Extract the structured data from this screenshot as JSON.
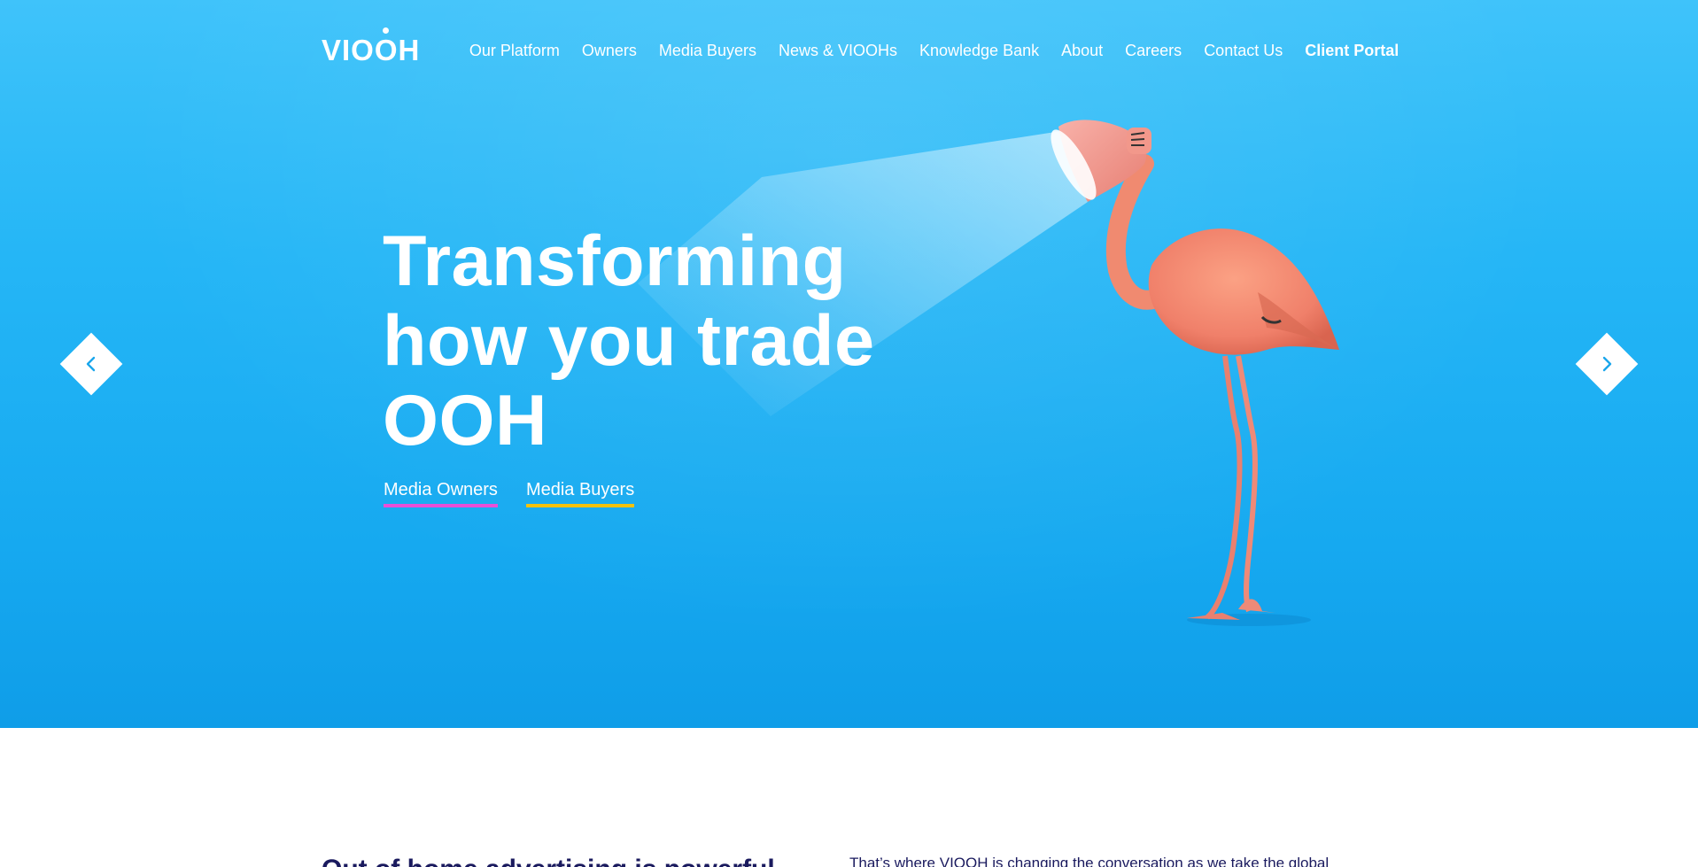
{
  "header": {
    "logo_text": "VIOOH",
    "nav": [
      {
        "label": "Our Platform"
      },
      {
        "label": "Owners"
      },
      {
        "label": "Media Buyers"
      },
      {
        "label": "News & VIOOHs"
      },
      {
        "label": "Knowledge Bank"
      },
      {
        "label": "About"
      },
      {
        "label": "Careers"
      },
      {
        "label": "Contact Us"
      },
      {
        "label": "Client Portal"
      }
    ]
  },
  "hero": {
    "headline_lines": [
      "Transforming",
      "how you trade",
      "OOH"
    ],
    "links": {
      "media_owners": "Media Owners",
      "media_buyers": "Media Buyers"
    },
    "colors": {
      "background": "#25b6f6",
      "owners_underline": "#e94fd8",
      "buyers_underline": "#f4c20d"
    },
    "icons": {
      "prev": "chevron-left-icon",
      "next": "chevron-right-icon"
    }
  },
  "intro": {
    "heading": "Out of home advertising is powerful",
    "text": "That’s where VIOOH is changing the conversation as we take the global"
  }
}
